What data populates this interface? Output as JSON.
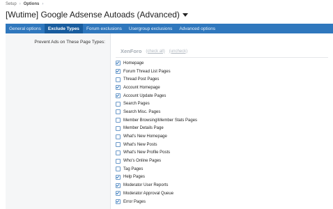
{
  "breadcrumb": {
    "items": [
      "Setup",
      "Options"
    ]
  },
  "page": {
    "title": "[Wutime] Google Adsense Autoads (Advanced)"
  },
  "tabs": [
    {
      "label": "General options",
      "active": false
    },
    {
      "label": "Exclude Types",
      "active": true
    },
    {
      "label": "Forum exclusions",
      "active": false
    },
    {
      "label": "Usergroup exclusions",
      "active": false
    },
    {
      "label": "Advanced options",
      "active": false
    }
  ],
  "form": {
    "field_label": "Prevent Ads on These Page Types:",
    "section": {
      "title": "XenForo",
      "check_all_label": "(check all)",
      "uncheck_label": "(uncheck)"
    },
    "options": [
      {
        "label": "Homepage",
        "checked": true
      },
      {
        "label": "Forum Thread List Pages",
        "checked": true
      },
      {
        "label": "Thread Post Pages",
        "checked": false
      },
      {
        "label": "Account Homepage",
        "checked": true
      },
      {
        "label": "Account Update Pages",
        "checked": true
      },
      {
        "label": "Search Pages",
        "checked": false
      },
      {
        "label": "Search Misc. Pages",
        "checked": false
      },
      {
        "label": "Member Browsing\\Member Stats Pages",
        "checked": false
      },
      {
        "label": "Member Details Page",
        "checked": false
      },
      {
        "label": "What's New Homepage",
        "checked": false
      },
      {
        "label": "What's New Posts",
        "checked": false
      },
      {
        "label": "What's New Profile Posts",
        "checked": false
      },
      {
        "label": "Who's Online Pages",
        "checked": false
      },
      {
        "label": "Tag Pages",
        "checked": false
      },
      {
        "label": "Help Pages",
        "checked": true
      },
      {
        "label": "Moderator User Reports",
        "checked": true
      },
      {
        "label": "Moderator Approval Queue",
        "checked": true
      },
      {
        "label": "Error Pages",
        "checked": true
      }
    ]
  },
  "colors": {
    "tab_bar": "#2f77bd",
    "tab_active": "#185c9e",
    "label_column": "#f5f6f7",
    "checkbox_border": "#6b99c9"
  },
  "icons": {
    "title_caret": "caret-down-icon",
    "breadcrumb_separator": "chevron-right-icon",
    "checkbox_check": "checkmark-icon"
  }
}
